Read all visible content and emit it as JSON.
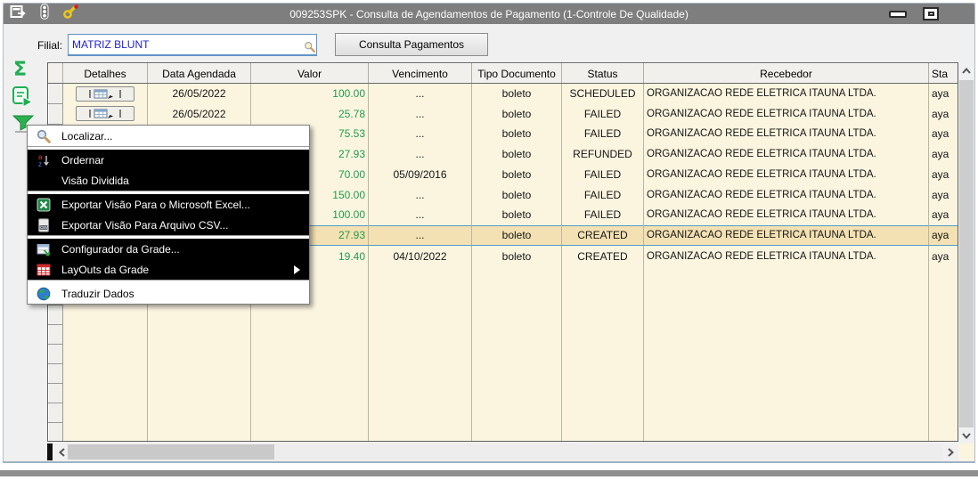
{
  "titlebar": {
    "title": "009253SPK - Consulta de Agendamentos de Pagamento (1-Controle De Qualidade)"
  },
  "toolbar": {
    "filial_label": "Filial:",
    "filial_value": "MATRIZ BLUNT",
    "consulta_button_label": "Consulta Pagamentos"
  },
  "grid": {
    "columns": {
      "detalhes": "Detalhes",
      "data_agendada": "Data Agendada",
      "valor": "Valor",
      "vencimento": "Vencimento",
      "tipo_documento": "Tipo Documento",
      "status": "Status",
      "recebedor": "Recebedor",
      "sta": "Sta"
    },
    "rows": [
      {
        "data_agendada": "26/05/2022",
        "valor": "100.00",
        "vencimento": "...",
        "tipo_documento": "boleto",
        "status": "SCHEDULED",
        "recebedor": "ORGANIZACAO REDE ELETRICA ITAUNA LTDA.",
        "sta": "aya",
        "selected": false
      },
      {
        "data_agendada": "26/05/2022",
        "valor": "25.78",
        "vencimento": "...",
        "tipo_documento": "boleto",
        "status": "FAILED",
        "recebedor": "ORGANIZACAO REDE ELETRICA ITAUNA LTDA.",
        "sta": "aya",
        "selected": false
      },
      {
        "data_agendada": "",
        "valor": "75.53",
        "vencimento": "...",
        "tipo_documento": "boleto",
        "status": "FAILED",
        "recebedor": "ORGANIZACAO REDE ELETRICA ITAUNA LTDA.",
        "sta": "aya",
        "selected": false
      },
      {
        "data_agendada": "",
        "valor": "27.93",
        "vencimento": "...",
        "tipo_documento": "boleto",
        "status": "REFUNDED",
        "recebedor": "ORGANIZACAO REDE ELETRICA ITAUNA LTDA.",
        "sta": "aya",
        "selected": false
      },
      {
        "data_agendada": "",
        "valor": "70.00",
        "vencimento": "05/09/2016",
        "tipo_documento": "boleto",
        "status": "FAILED",
        "recebedor": "ORGANIZACAO REDE ELETRICA ITAUNA LTDA.",
        "sta": "aya",
        "selected": false
      },
      {
        "data_agendada": "",
        "valor": "150.00",
        "vencimento": "...",
        "tipo_documento": "boleto",
        "status": "FAILED",
        "recebedor": "ORGANIZACAO REDE ELETRICA ITAUNA LTDA.",
        "sta": "aya",
        "selected": false
      },
      {
        "data_agendada": "",
        "valor": "100.00",
        "vencimento": "...",
        "tipo_documento": "boleto",
        "status": "FAILED",
        "recebedor": "ORGANIZACAO REDE ELETRICA ITAUNA LTDA.",
        "sta": "aya",
        "selected": false
      },
      {
        "data_agendada": "",
        "valor": "27.93",
        "vencimento": "...",
        "tipo_documento": "boleto",
        "status": "CREATED",
        "recebedor": "ORGANIZACAO REDE ELETRICA ITAUNA LTDA.",
        "sta": "aya",
        "selected": true
      },
      {
        "data_agendada": "",
        "valor": "19.40",
        "vencimento": "04/10/2022",
        "tipo_documento": "boleto",
        "status": "CREATED",
        "recebedor": "ORGANIZACAO REDE ELETRICA ITAUNA LTDA.",
        "sta": "aya",
        "selected": false
      }
    ]
  },
  "context_menu": {
    "items": [
      {
        "label": "Localizar...",
        "icon": "magnifier-icon"
      },
      {
        "label": "Ordernar",
        "icon": "sort-az-icon"
      },
      {
        "label": "Visão Dividida",
        "icon": "none"
      },
      {
        "label": "Exportar Visão Para o Microsoft Excel...",
        "icon": "excel-icon"
      },
      {
        "label": "Exportar Visão Para Arquivo CSV...",
        "icon": "csv-file-icon"
      },
      {
        "label": "Configurador da Grade...",
        "icon": "grid-config-icon"
      },
      {
        "label": "LayOuts da Grade",
        "icon": "grid-layout-icon",
        "has_submenu": true
      },
      {
        "label": "Traduzir Dados",
        "icon": "globe-icon"
      }
    ]
  },
  "colors": {
    "titlebar_gray": "#7e7e7e",
    "grid_bg_cream": "#fbf5e0",
    "selected_row_bg": "#f4e1b3",
    "selection_border_blue": "#4f9dc6",
    "value_green": "#229a4d",
    "filial_text_blue": "#2121cc",
    "menu_dark_bg": "#000000",
    "sidebar_icon_green": "#1fae54"
  }
}
